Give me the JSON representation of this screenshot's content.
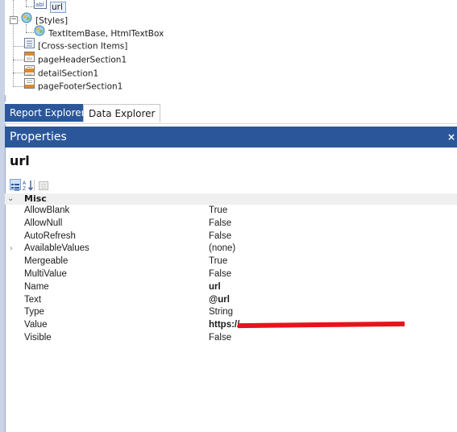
{
  "tree": {
    "items": [
      {
        "label": "url"
      },
      {
        "label": "[Styles]"
      },
      {
        "label": "TextItemBase, HtmlTextBox"
      },
      {
        "label": "[Cross-section Items]"
      },
      {
        "label": "pageHeaderSection1"
      },
      {
        "label": "detailSection1"
      },
      {
        "label": "pageFooterSection1"
      }
    ]
  },
  "tabs": [
    {
      "label": "Report Explorer",
      "active": true
    },
    {
      "label": "Data Explorer",
      "active": false
    }
  ],
  "properties": {
    "title": "Properties",
    "close_glyph": "×",
    "object_name": "url",
    "category": "Misc",
    "rows": [
      {
        "name": "AllowBlank",
        "value": "True"
      },
      {
        "name": "AllowNull",
        "value": "False"
      },
      {
        "name": "AutoRefresh",
        "value": "False"
      },
      {
        "name": "AvailableValues",
        "value": "(none)",
        "expandable": true
      },
      {
        "name": "Mergeable",
        "value": "True"
      },
      {
        "name": "MultiValue",
        "value": "False"
      },
      {
        "name": "Name",
        "value": "url",
        "bold": true
      },
      {
        "name": "Text",
        "value": "@url",
        "bold": true
      },
      {
        "name": "Type",
        "value": "String"
      },
      {
        "name": "Value",
        "value": "https://",
        "bold": true,
        "redacted": true
      },
      {
        "name": "Visible",
        "value": "False"
      }
    ]
  },
  "colors": {
    "accent": "#2b579a",
    "redaction": "#e8141b"
  }
}
